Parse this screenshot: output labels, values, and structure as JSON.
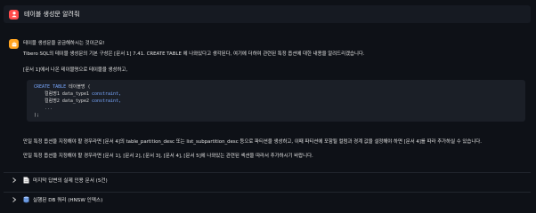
{
  "user_message": {
    "text": "테이블 생성문 알려줘"
  },
  "assistant_message": {
    "intro": "테이블 생성문을 궁금해하시는 것이군요!",
    "line1": "Tibero SQL의 테이블 생성문의 기본 구성은 [문서 1] 7.41. CREATE TABLE 에 나와있다고 생각된다, 여기에 더하여 관련된 특정 옵션에 대한 내용을 알려드리겠습니다.",
    "line2": "[문서 1]에서 나온 테이블명으로 테이블을 생성하고,",
    "code": {
      "line1_kw": "CREATE TABLE",
      "line1_rest": " 테이블명 (",
      "line2_col": "    컬럼명1 data_type1",
      "line2_constraint": " constraint,",
      "line3_col": "    컬럼명2 data_type2",
      "line3_constraint": " constraint,",
      "line4": "    ...",
      "line5": ");"
    },
    "line3": "만일 특정 옵션을 지정해야 할 경우라면 [문서 4]의 table_partition_desc 또는 list_subpartition_desc 등으로 파티션을 생성하고, 이때 파티션에 포함될 컬럼과 경계 값을 설정해야 하면 [문서 4]를 따라 추가하실 수 있습니다.",
    "line4": "만일 특정 옵션을 지정해야 할 경우라면 [문서 1], [문서 2], [문서 3], [문서 4], [문서 5]에 나와있는 관련된 섹션을 따라서 추가하시기 바랍니다."
  },
  "expanders": [
    {
      "label": "마지막 답변의 실제 인용 문서 (5건)",
      "icon": "document-icon"
    },
    {
      "label": "실행된 DB 쿼리 (HNSW 인덱스)",
      "icon": "database-icon"
    }
  ],
  "colors": {
    "background": "#0e1117",
    "user_avatar": "#ff4b4b",
    "assistant_avatar": "#ffa421",
    "code_keyword": "#79a8ff"
  }
}
